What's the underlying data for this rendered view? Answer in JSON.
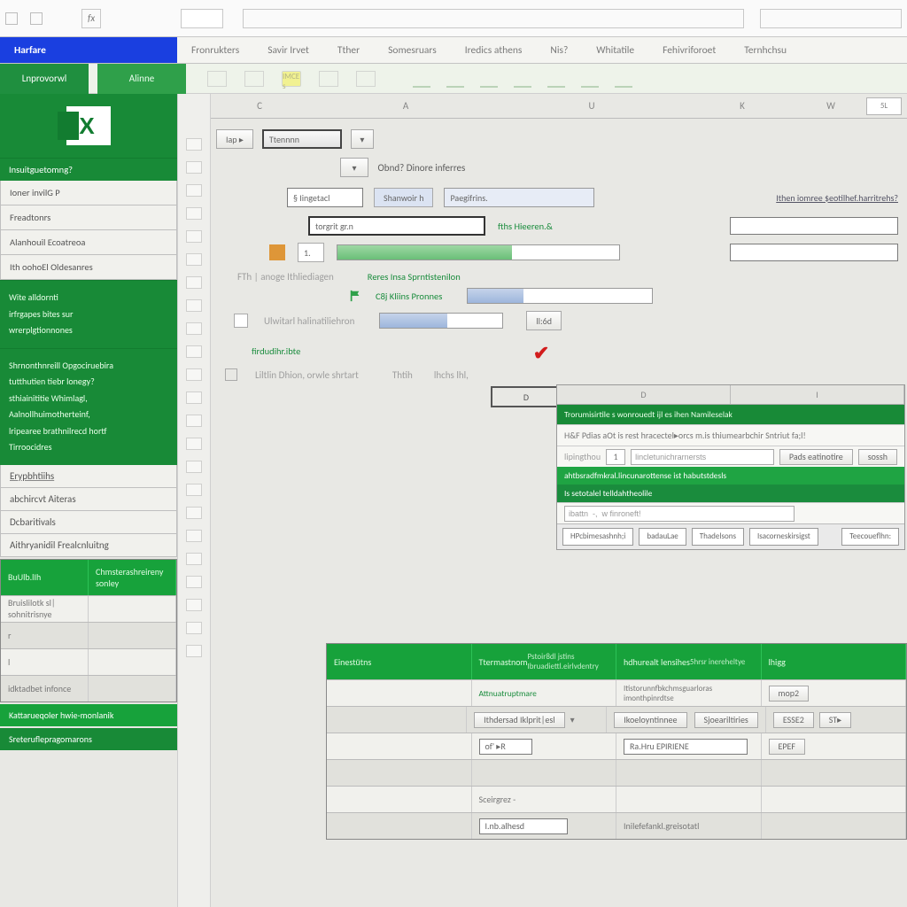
{
  "qat": {
    "ref": "fx"
  },
  "ribbon_tabs": [
    "Harfare",
    "Fronrukters",
    "Savir Irvet",
    "Tther",
    "Somesruars",
    "Iredics athens",
    "Nis?",
    "Whitatile",
    "Fehivriforoet",
    "Ternhchsu"
  ],
  "subribbon": {
    "file": "Lnprovorwl",
    "tab": "Alinne",
    "yellow": "IMCE s"
  },
  "col_headers": [
    "C",
    "A",
    "U",
    "K",
    "W"
  ],
  "col_end_chip": "5L",
  "sidebar": {
    "section1_title": "Insuitguetomng?",
    "rows1": [
      "Ioner invilG P",
      "Freadtonrs",
      "Alanhouil Ecoatreoa",
      "Ith oohoEl Oldesanres"
    ],
    "block1": [
      "Wite alldornti",
      "irfrgapes bites sur",
      "wrerplgtionnones"
    ],
    "block2": [
      "Shrnonthnreill Opgociruebira",
      "tutthutien tiebr lonegy?",
      "sthiainititie Whimlagl,",
      "Aalnollhuimotherteinf,",
      "lripearee brathnilrecd hortf",
      "Tirroocidres"
    ],
    "rows2": [
      "Erypbhtiihs",
      "abchircvt Aiteras",
      "Dcbaritivals",
      "Aithryanidil Frealcnluitng"
    ],
    "tableA_hdr": [
      "BuUlb.lIh",
      "Chmsterashreireny sonley"
    ],
    "tableA_rows": [
      "Bruislilotk sl| sohnitrisnye",
      "r",
      "l",
      "idktadbet infonce"
    ],
    "tableA_green1": "Kattarueqoler hwie-monlanik",
    "tableA_green2": "Sreteruflepragomarons"
  },
  "panelA": {
    "btn1": "Iap ▸",
    "btn2": "Ttennnn",
    "dd1": "▾",
    "title": "Obnd? Dinore inferres",
    "row2_a": "§ Iingetacl",
    "row2_b": "Shanwoir h",
    "row2_c": "Paegifrins.",
    "row2_link": "Ithen iomree $eotilhef.harritrehs?",
    "row3_inp": "torgrit gr.n",
    "row3_green": "fths Hieeren.&",
    "row4_lbl": "FTh | anoge Ithliediagen",
    "row4_green": "Reres Insa Sprntistenilon",
    "row5_green": "C8j Kliins Pronnes",
    "row6_lbl": "Ulwitarl halinatiliehron",
    "row6_btn": "ll:6d",
    "row7_green": "firdudihr.ibte",
    "row8_lbl1": "Liltlin Dhion, orwle shrtart",
    "row8_lbl2": "Thtih",
    "row8_lbl3": "lhchs lhl,",
    "boxD": "D"
  },
  "inset": {
    "hdr": [
      "D",
      "I"
    ],
    "green1": "Trorumisirtile s wonrouedt ijl es ihen Namileselak",
    "row1": "H&F Pdias aOt is rest hracectel▸orcs m.is thiumearbchir Sntriut fa;l!",
    "num": "1",
    "inp1": "lincletunichrarnersts",
    "chip1": "Pads eatinotire",
    "chip2": "sossh",
    "green2a": "ahtbsradfmkral.lincunarottense ist habutstdesls",
    "green2b": "Is setotalel telldahtheolile",
    "inp2": "ibattn  -,  w finroneft!",
    "btns": [
      "HPcbimesashnh;i",
      "badauLae",
      "Thadelsons",
      "Isacorneskirsigst",
      "Teecoueflhn:"
    ]
  },
  "lower": {
    "hdr": [
      "Einestütns",
      "Ttermastnom",
      "hdhurealt lensihes",
      "lhigg",
      "",
      ""
    ],
    "sub1": "Pstoir8dl jstins Ibruadiettl.eirlvdentry",
    "sub2": "5hrsr inereheltye",
    "row1_a": "Attnuatruptmare",
    "row1_b": "Itistorunnfbkchmsguarloras imonthpinrdtse",
    "row1_c": "mop2",
    "row2_a": "Ithdersad Iklprit|esl",
    "row2_chip1": "Ikoeloyntinnee",
    "row2_chip2": "Sjoeariltiries",
    "row2_chip3": "ESSE2",
    "row2_chip4": "ST▸",
    "row3_a": "of' ▸R",
    "row3_b": "Ra.Hru EPIRIENE",
    "row3_c": "EPEF",
    "row4_a": "Sceirgrez -",
    "row4_b": "I.nb.alhesd",
    "row4_c": "Inilefefankl.greisotatl"
  }
}
